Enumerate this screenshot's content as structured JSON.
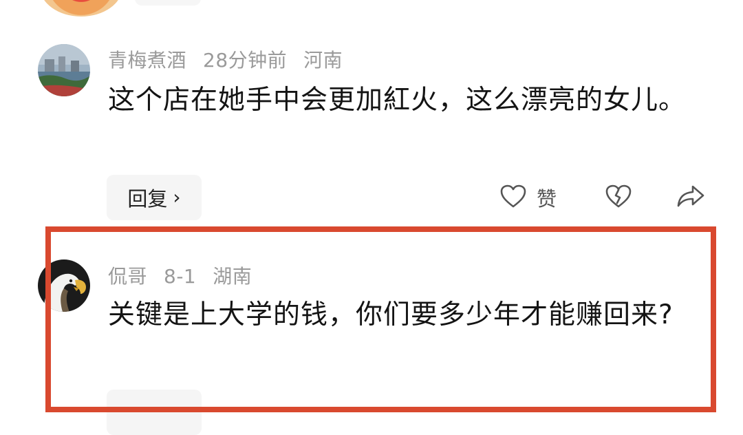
{
  "comments": [
    {
      "username": "青梅煮酒",
      "time": "28分钟前",
      "location": "河南",
      "text": "这个店在她手中会更加紅火，这么漂亮的女儿。",
      "reply_label": "回复",
      "like_label": "赞"
    },
    {
      "username": "侃哥",
      "time": "8-1",
      "location": "湖南",
      "text": "关键是上大学的钱，你们要多少年才能赚回来?"
    }
  ],
  "icons": {
    "like": "heart-outline-icon",
    "dislike": "broken-heart-icon",
    "share": "share-arrow-icon"
  },
  "colors": {
    "highlight_border": "#d9492f",
    "meta_text": "#9a9a9a"
  }
}
